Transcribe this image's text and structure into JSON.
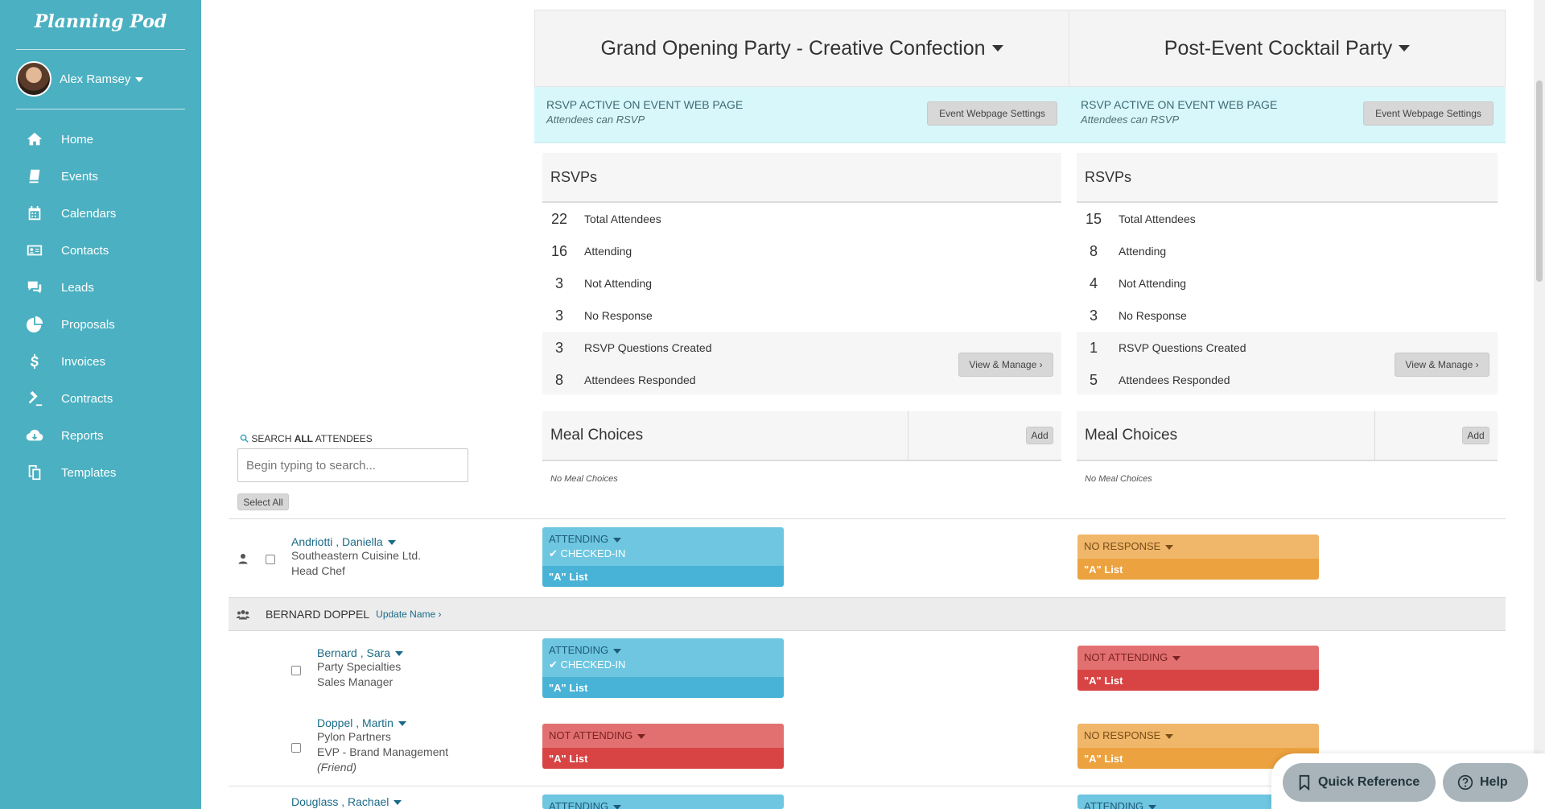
{
  "sidebar": {
    "brand": "Planning Pod",
    "user_name": "Alex Ramsey",
    "items": [
      {
        "label": "Home",
        "icon": "home-icon"
      },
      {
        "label": "Events",
        "icon": "book-icon"
      },
      {
        "label": "Calendars",
        "icon": "calendar-icon"
      },
      {
        "label": "Contacts",
        "icon": "contact-card-icon"
      },
      {
        "label": "Leads",
        "icon": "chat-icon"
      },
      {
        "label": "Proposals",
        "icon": "pie-chart-icon"
      },
      {
        "label": "Invoices",
        "icon": "dollar-icon"
      },
      {
        "label": "Contracts",
        "icon": "gavel-icon"
      },
      {
        "label": "Reports",
        "icon": "cloud-download-icon"
      },
      {
        "label": "Templates",
        "icon": "copy-icon"
      }
    ]
  },
  "events": [
    {
      "title": "Grand Opening Party - Creative Confection",
      "rsvp_active": "RSVP ACTIVE ON EVENT WEB PAGE",
      "rsvp_sub": "Attendees can RSVP",
      "settings_button": "Event Webpage Settings",
      "rsvps_title": "RSVPs",
      "stats": [
        {
          "num": "22",
          "label": "Total Attendees"
        },
        {
          "num": "16",
          "label": "Attending"
        },
        {
          "num": "3",
          "label": "Not Attending"
        },
        {
          "num": "3",
          "label": "No Response"
        }
      ],
      "questions": [
        {
          "num": "3",
          "label": "RSVP Questions Created"
        },
        {
          "num": "8",
          "label": "Attendees Responded"
        }
      ],
      "view_manage": "View & Manage",
      "meal_title": "Meal Choices",
      "add_button": "Add",
      "no_meal": "No Meal Choices"
    },
    {
      "title": "Post-Event Cocktail Party",
      "rsvp_active": "RSVP ACTIVE ON EVENT WEB PAGE",
      "rsvp_sub": "Attendees can RSVP",
      "settings_button": "Event Webpage Settings",
      "rsvps_title": "RSVPs",
      "stats": [
        {
          "num": "15",
          "label": "Total Attendees"
        },
        {
          "num": "8",
          "label": "Attending"
        },
        {
          "num": "4",
          "label": "Not Attending"
        },
        {
          "num": "3",
          "label": "No Response"
        }
      ],
      "questions": [
        {
          "num": "1",
          "label": "RSVP Questions Created"
        },
        {
          "num": "5",
          "label": "Attendees Responded"
        }
      ],
      "view_manage": "View & Manage",
      "meal_title": "Meal Choices",
      "add_button": "Add",
      "no_meal": "No Meal Choices"
    }
  ],
  "search": {
    "label_pre": "SEARCH ",
    "label_bold": "ALL",
    "label_post": " ATTENDEES",
    "placeholder": "Begin typing to search...",
    "select_all": "Select All"
  },
  "attendees": [
    {
      "name": "Andriotti , Daniella",
      "company": "Southeastern Cuisine Ltd.",
      "role": "Head Chef",
      "ev1": {
        "status": "ATTENDING",
        "checked": "CHECKED-IN",
        "list": "\"A\" List"
      },
      "ev2": {
        "status": "NO RESPONSE",
        "list": "\"A\" List"
      }
    },
    {
      "name": "Bernard , Sara",
      "company": "Party Specialties",
      "role": "Sales Manager",
      "ev1": {
        "status": "ATTENDING",
        "checked": "CHECKED-IN",
        "list": "\"A\" List"
      },
      "ev2": {
        "status": "NOT ATTENDING",
        "list": "\"A\" List"
      }
    },
    {
      "name": "Doppel , Martin",
      "company": "Pylon Partners",
      "role": "EVP - Brand Management",
      "note": "(Friend)",
      "ev1": {
        "status": "NOT ATTENDING",
        "list": "\"A\" List"
      },
      "ev2": {
        "status": "NO RESPONSE",
        "list": "\"A\" List"
      }
    },
    {
      "name": "Douglass , Rachael",
      "ev1": {
        "status": "ATTENDING"
      },
      "ev2": {
        "status": "ATTENDING"
      }
    }
  ],
  "group": {
    "name": "BERNARD DOPPEL",
    "update_link": "Update Name"
  },
  "footer": {
    "quick_reference": "Quick Reference",
    "help": "Help"
  }
}
